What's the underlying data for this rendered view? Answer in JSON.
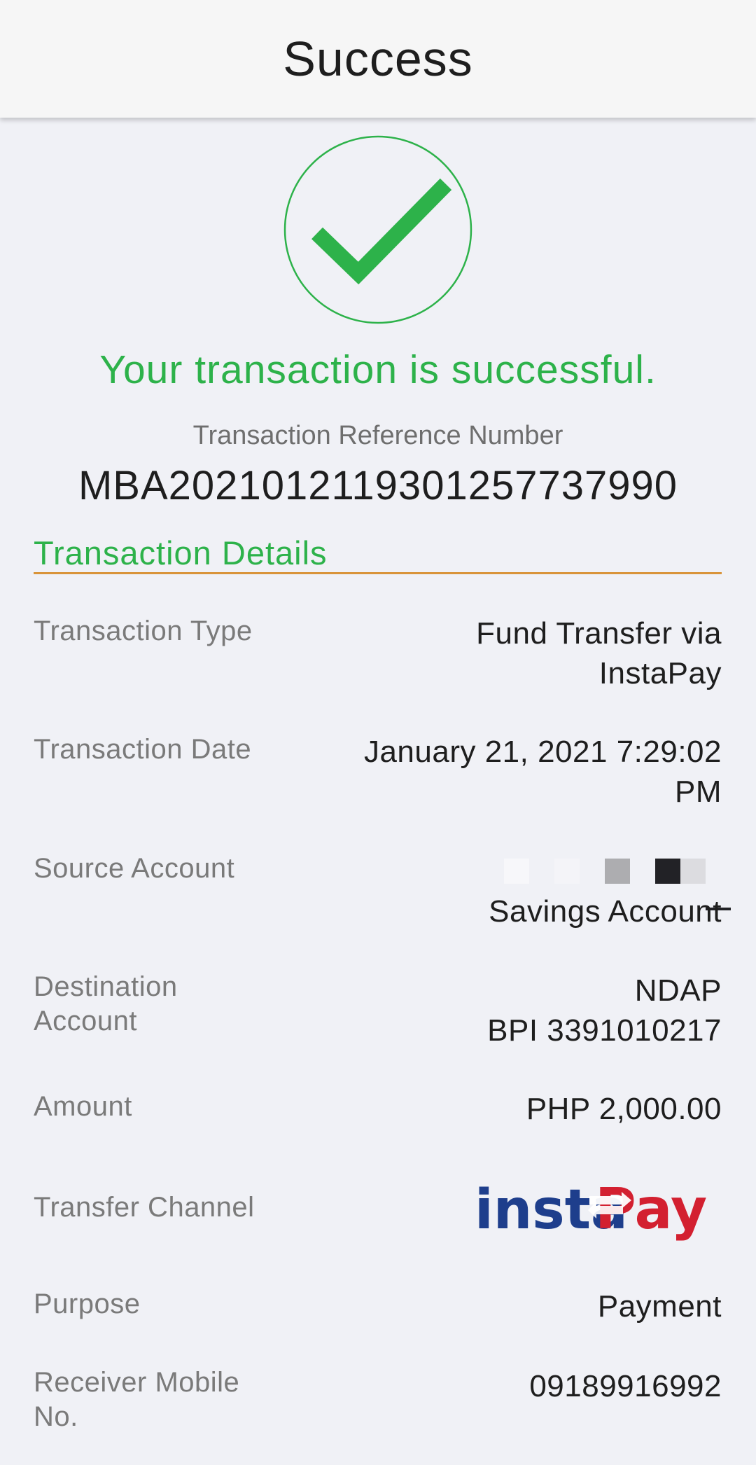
{
  "header": {
    "title": "Success"
  },
  "status": {
    "icon": "check-circle-icon",
    "message": "Your transaction is successful.",
    "accent_color": "#2db24a"
  },
  "reference": {
    "label": "Transaction Reference Number",
    "number": "MBA20210121193012577379​90"
  },
  "details": {
    "title": "Transaction Details",
    "transaction_type": {
      "label": "Transaction Type",
      "value_line1": "Fund Transfer via",
      "value_line2": "InstaPay"
    },
    "transaction_date": {
      "label": "Transaction Date",
      "value_line1": "January 21, 2021 7:29:02",
      "value_line2": "PM"
    },
    "source_account": {
      "label": "Source Account",
      "value": "Savings Account"
    },
    "destination_account": {
      "label_line1": "Destination",
      "label_line2": "Account",
      "value_line1": "NDAP",
      "value_line2": "BPI 3391010217"
    },
    "amount": {
      "label": "Amount",
      "value": "PHP 2,000.00"
    },
    "transfer_channel": {
      "label": "Transfer Channel",
      "logo_text_insta": "insta",
      "logo_text_pay": "Pay",
      "logo_icon": "instapay-logo"
    },
    "purpose": {
      "label": "Purpose",
      "value": "Payment"
    },
    "receiver_mobile": {
      "label_line1": "Receiver Mobile",
      "label_line2": "No.",
      "value": "09189916992"
    }
  },
  "colors": {
    "instapay_blue": "#1e3e8c",
    "instapay_red": "#d32030",
    "divider": "#d9943a"
  }
}
